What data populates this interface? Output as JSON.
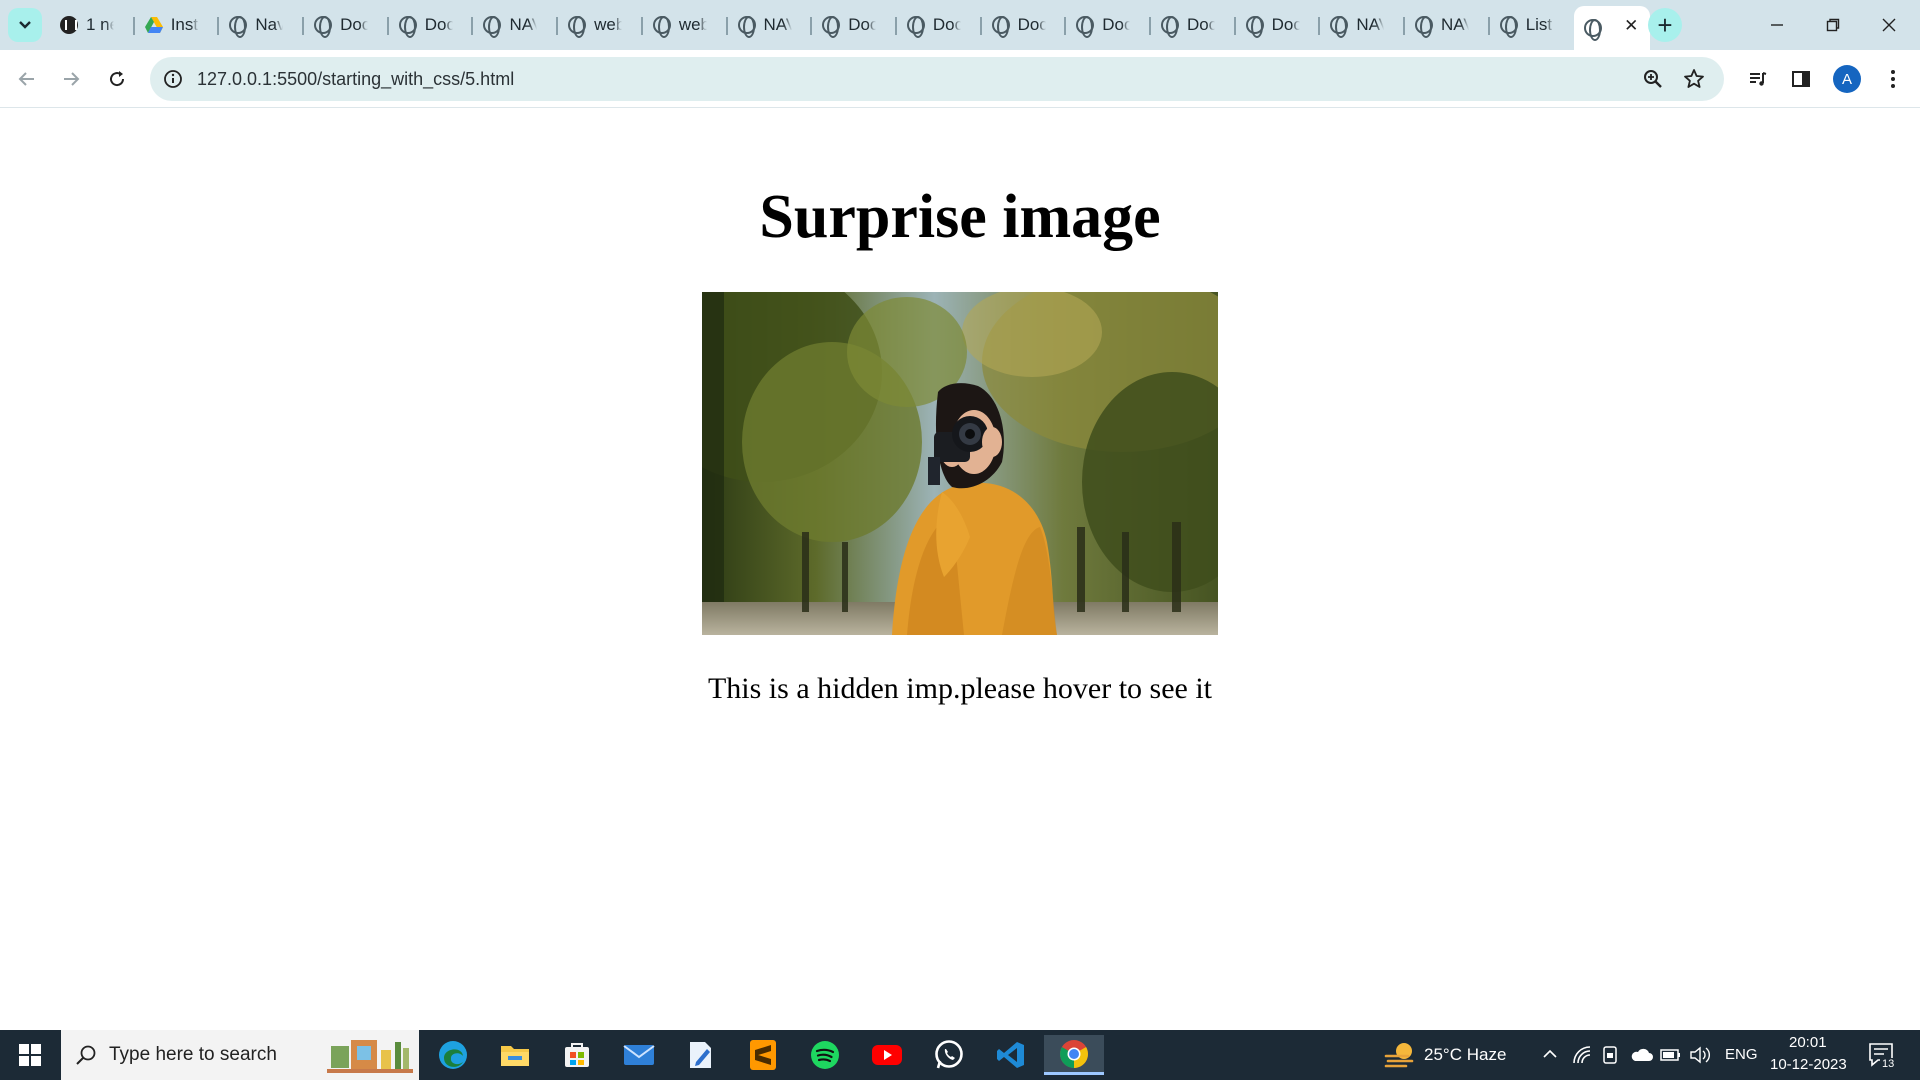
{
  "browser": {
    "tabs": [
      {
        "label": "1 ne",
        "icon": "wiki-icon"
      },
      {
        "label": "Inst",
        "icon": "drive-icon"
      },
      {
        "label": "Nav",
        "icon": "globe-icon"
      },
      {
        "label": "Doc",
        "icon": "globe-icon"
      },
      {
        "label": "Doc",
        "icon": "globe-icon"
      },
      {
        "label": "NAV",
        "icon": "globe-icon"
      },
      {
        "label": "web",
        "icon": "globe-icon"
      },
      {
        "label": "web",
        "icon": "globe-icon"
      },
      {
        "label": "NAV",
        "icon": "globe-icon"
      },
      {
        "label": "Doc",
        "icon": "globe-icon"
      },
      {
        "label": "Doc",
        "icon": "globe-icon"
      },
      {
        "label": "Doc",
        "icon": "globe-icon"
      },
      {
        "label": "Doc",
        "icon": "globe-icon"
      },
      {
        "label": "Doc",
        "icon": "globe-icon"
      },
      {
        "label": "Doc",
        "icon": "globe-icon"
      },
      {
        "label": "NAV",
        "icon": "globe-icon"
      },
      {
        "label": "NAV",
        "icon": "globe-icon"
      },
      {
        "label": "List",
        "icon": "globe-icon"
      }
    ],
    "active_tab_close": "✕",
    "new_tab_label": "+",
    "url": "127.0.0.1:5500/starting_with_css/5.html",
    "profile_initial": "A"
  },
  "page": {
    "title": "Surprise image",
    "caption": "This is a hidden imp.please hover to see it"
  },
  "taskbar": {
    "search_placeholder": "Type here to search",
    "weather": "25°C  Haze",
    "language": "ENG",
    "time": "20:01",
    "date": "10-12-2023",
    "notification_count": "13"
  },
  "colors": {
    "tabstrip_bg": "#d3e3ea",
    "accent": "#a8f0ec",
    "omnibox_bg": "#dfeeef",
    "taskbar_bg": "#1c2a36"
  }
}
